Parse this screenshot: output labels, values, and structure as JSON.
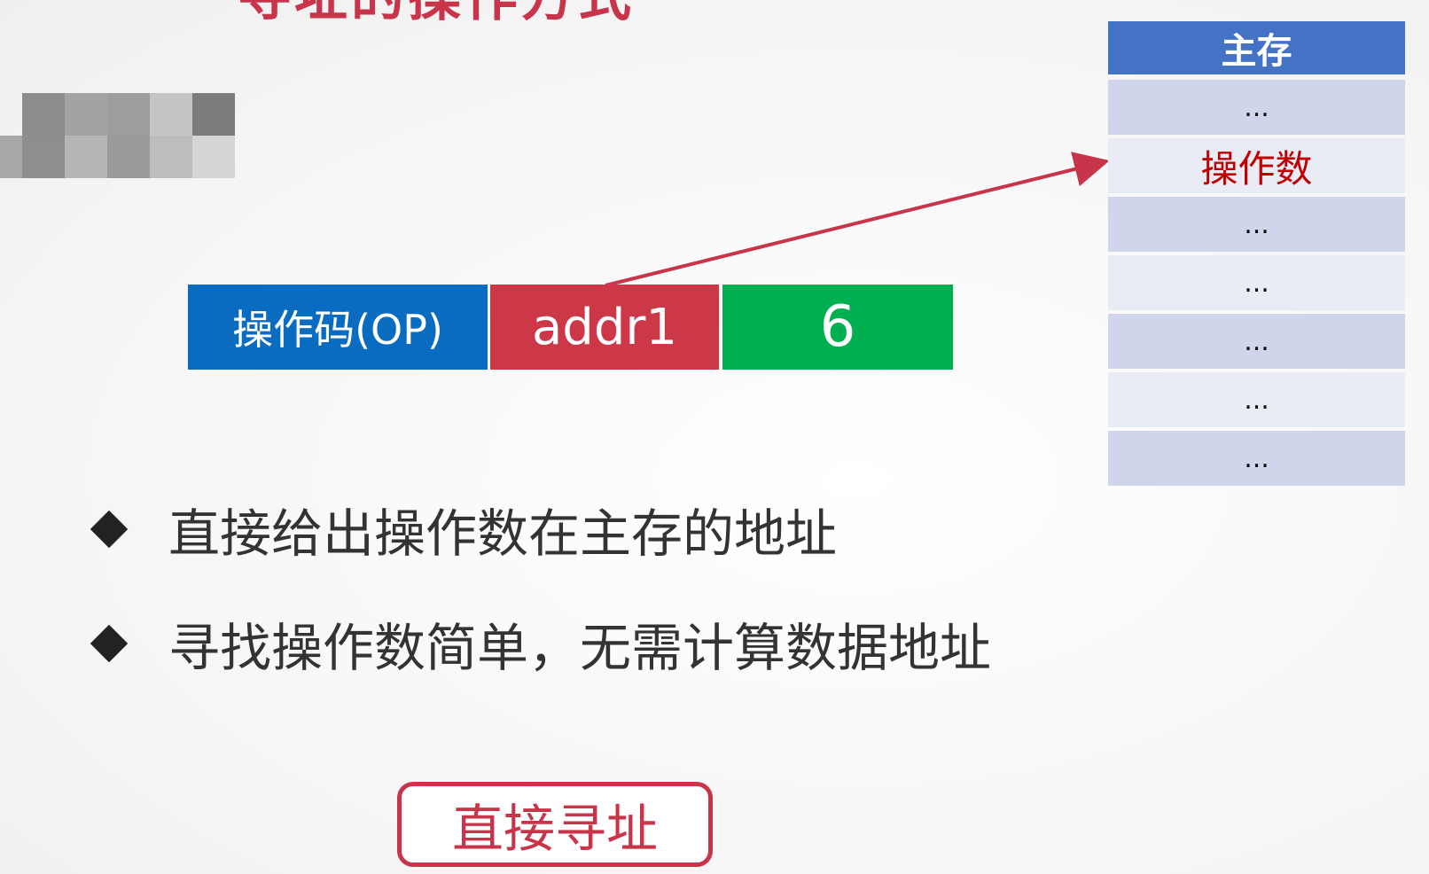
{
  "header": {
    "title_fragment": "寻址的操作方式"
  },
  "instruction": {
    "opcode": "操作码(OP)",
    "address": "addr1",
    "mode": "6"
  },
  "bullets": [
    "直接给出操作数在主存的地址",
    "寻找操作数简单，无需计算数据地址"
  ],
  "memory": {
    "header": "主存",
    "cells": [
      "...",
      "操作数",
      "...",
      "...",
      "...",
      "...",
      "..."
    ]
  },
  "label": "直接寻址",
  "colors": {
    "opcode": "#0a6cc0",
    "address": "#cc3848",
    "mode": "#00b050",
    "memory_header": "#4472c4",
    "accent": "#c8354a"
  }
}
